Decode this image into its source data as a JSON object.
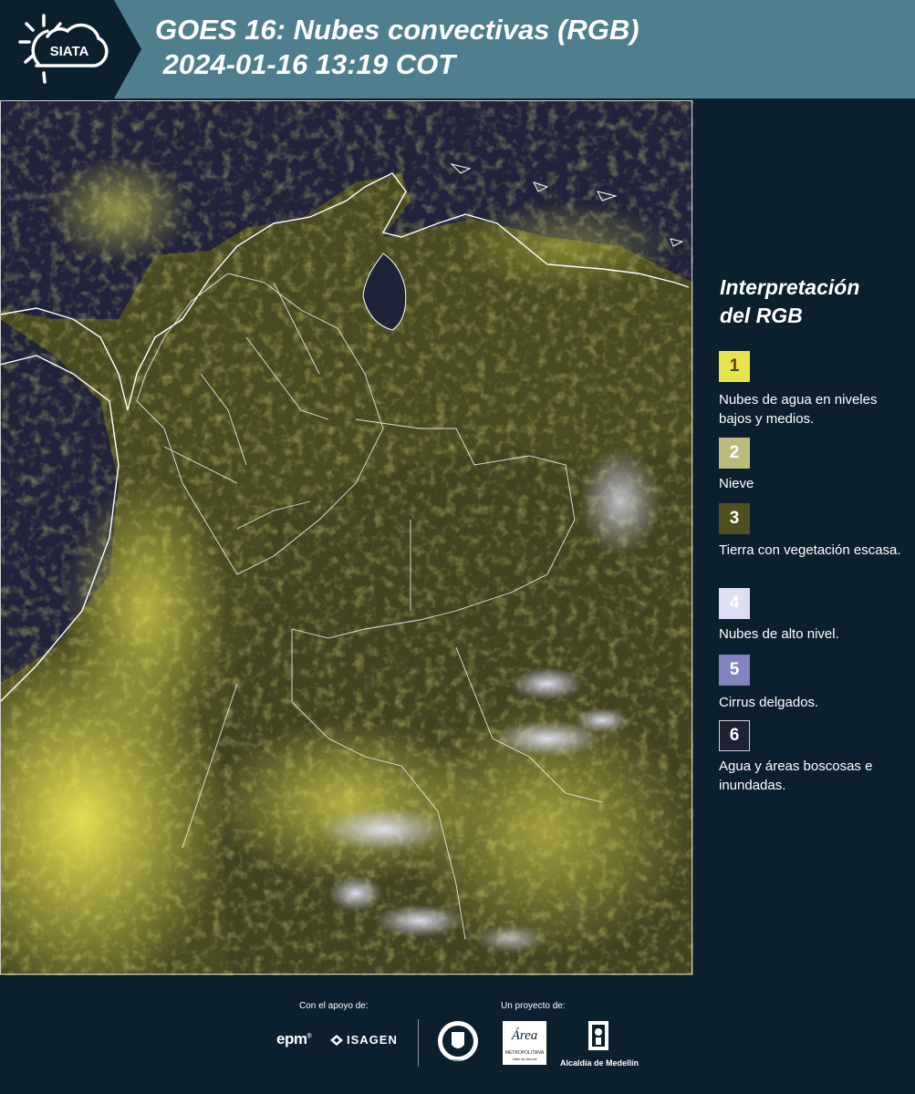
{
  "header": {
    "logo_text": "SIATA",
    "title_line1": "GOES 16: Nubes convectivas (RGB)",
    "title_line2": " 2024-01-16 13:19 COT"
  },
  "legend": {
    "title_line1": "Interpretación",
    "title_line2": "del RGB",
    "items": [
      {
        "number": "1",
        "label": "Nubes de agua en niveles bajos y medios.",
        "color": "#e6e34e"
      },
      {
        "number": "2",
        "label": "Nieve",
        "color": "#bcbb7c"
      },
      {
        "number": "3",
        "label": "Tierra con vegetación escasa.",
        "color": "#4f4f1f"
      },
      {
        "number": "4",
        "label": "Nubes de alto nivel.",
        "color": "#dedef5"
      },
      {
        "number": "5",
        "label": "Cirrus delgados.",
        "color": "#8283c0"
      },
      {
        "number": "6",
        "label": "Agua y áreas boscosas e inundadas.",
        "color": "#1e2134"
      }
    ]
  },
  "footer": {
    "support_label": "Con el apoyo de:",
    "project_label": "Un proyecto de:",
    "sponsor_epm": "epm",
    "sponsor_isagen": "ISAGEN",
    "partner_medellin_seal": "MEDELLÍN",
    "partner_area": "Área",
    "partner_area_sub": "METROPOLITANA",
    "partner_area_sub2": "Valle de Aburrá",
    "partner_alcaldia": "Alcaldía de Medellín"
  }
}
